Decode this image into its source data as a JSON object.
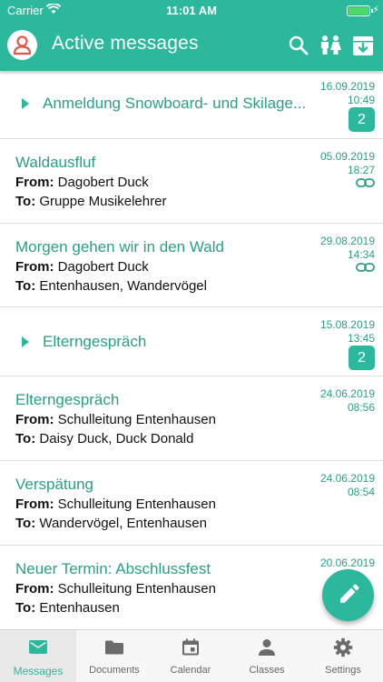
{
  "status_bar": {
    "carrier": "Carrier",
    "time": "11:01 AM"
  },
  "header": {
    "title": "Active messages",
    "icons": [
      "person-circle-icon",
      "search-icon",
      "children-icon",
      "archive-icon"
    ]
  },
  "messages": [
    {
      "type": "group",
      "title": "Anmeldung Snowboard- und Skilage...",
      "date": "16.09.2019",
      "time": "10:49",
      "count": "2"
    },
    {
      "type": "message",
      "title": "Waldausfluf",
      "from_label": "From:",
      "from": "Dagobert Duck",
      "to_label": "To:",
      "to": "Gruppe Musikelehrer",
      "date": "05.09.2019",
      "time": "18:27",
      "linked": true
    },
    {
      "type": "message",
      "title": "Morgen gehen wir in den Wald",
      "from_label": "From:",
      "from": "Dagobert Duck",
      "to_label": "To:",
      "to": "Entenhausen, Wandervögel",
      "date": "29.08.2019",
      "time": "14:34",
      "linked": true
    },
    {
      "type": "group",
      "title": "Elterngespräch",
      "date": "15.08.2019",
      "time": "13:45",
      "count": "2"
    },
    {
      "type": "message",
      "title": "Elterngespräch",
      "from_label": "From:",
      "from": "Schulleitung Entenhausen",
      "to_label": "To:",
      "to": "Daisy Duck, Duck Donald",
      "date": "24.06.2019",
      "time": "08:56",
      "linked": false
    },
    {
      "type": "message",
      "title": "Verspätung",
      "from_label": "From:",
      "from": "Schulleitung Entenhausen",
      "to_label": "To:",
      "to": "Wandervögel, Entenhausen",
      "date": "24.06.2019",
      "time": "08:54",
      "linked": false
    },
    {
      "type": "message",
      "title": "Neuer Termin: Abschlussfest",
      "from_label": "From:",
      "from": "Schulleitung Entenhausen",
      "to_label": "To:",
      "to": "Entenhausen",
      "date": "20.06.2019",
      "time": "",
      "linked": false
    }
  ],
  "fab": {
    "icon": "pencil-icon"
  },
  "tabs": [
    {
      "label": "Messages",
      "icon": "envelope-icon",
      "active": true
    },
    {
      "label": "Documents",
      "icon": "folder-icon",
      "active": false
    },
    {
      "label": "Calendar",
      "icon": "calendar-icon",
      "active": false
    },
    {
      "label": "Classes",
      "icon": "person-icon",
      "active": false
    },
    {
      "label": "Settings",
      "icon": "gear-icon",
      "active": false
    }
  ],
  "colors": {
    "accent": "#2cb89d",
    "accent_text": "#2a9e88",
    "avatar_red": "#e2574c"
  }
}
